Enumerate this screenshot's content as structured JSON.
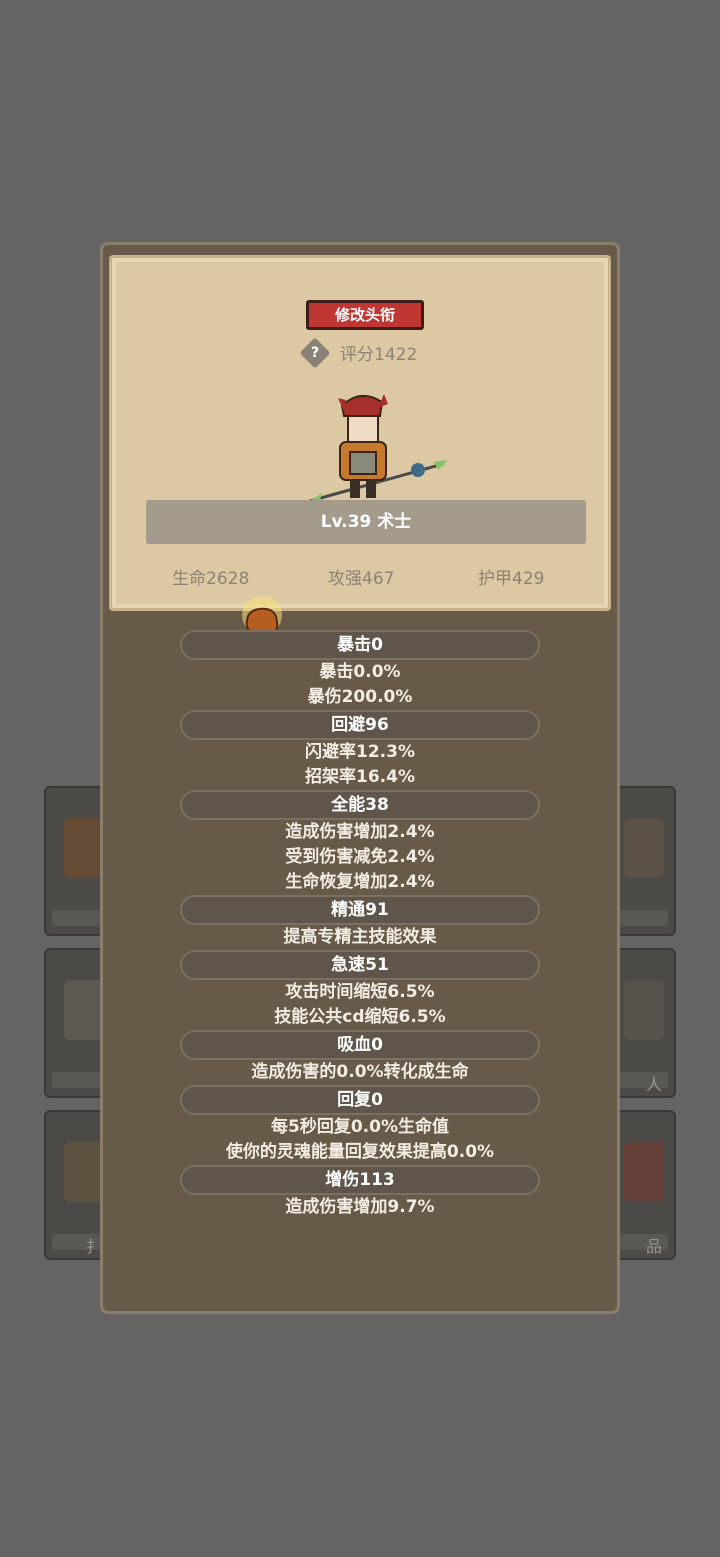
{
  "background_tiles": {
    "left_labels": [
      "",
      "",
      "扌"
    ],
    "right_labels": [
      "",
      "人",
      "品"
    ]
  },
  "panel": {
    "title_button": "修改头衔",
    "help_symbol": "?",
    "score_text": "评分1422",
    "level_text": "Lv.39 术士",
    "stats": {
      "hp": "生命2628",
      "attack": "攻强467",
      "armor": "护甲429"
    }
  },
  "attributes": [
    {
      "header": "暴击0",
      "lines": [
        "暴击0.0%",
        "暴伤200.0%"
      ]
    },
    {
      "header": "回避96",
      "lines": [
        "闪避率12.3%",
        "招架率16.4%"
      ]
    },
    {
      "header": "全能38",
      "lines": [
        "造成伤害增加2.4%",
        "受到伤害减免2.4%",
        "生命恢复增加2.4%"
      ]
    },
    {
      "header": "精通91",
      "lines": [
        "提高专精主技能效果"
      ]
    },
    {
      "header": "急速51",
      "lines": [
        "攻击时间缩短6.5%",
        "技能公共cd缩短6.5%"
      ]
    },
    {
      "header": "吸血0",
      "lines": [
        "造成伤害的0.0%转化成生命"
      ]
    },
    {
      "header": "回复0",
      "lines": [
        "每5秒回复0.0%生命值",
        "使你的灵魂能量回复效果提高0.0%"
      ]
    },
    {
      "header": "增伤113",
      "lines": [
        "造成伤害增加9.7%"
      ]
    }
  ],
  "colors": {
    "background": "#646464",
    "panel": "#675a49",
    "parchment": "#dcc8a2",
    "title_button": "#c03632"
  }
}
